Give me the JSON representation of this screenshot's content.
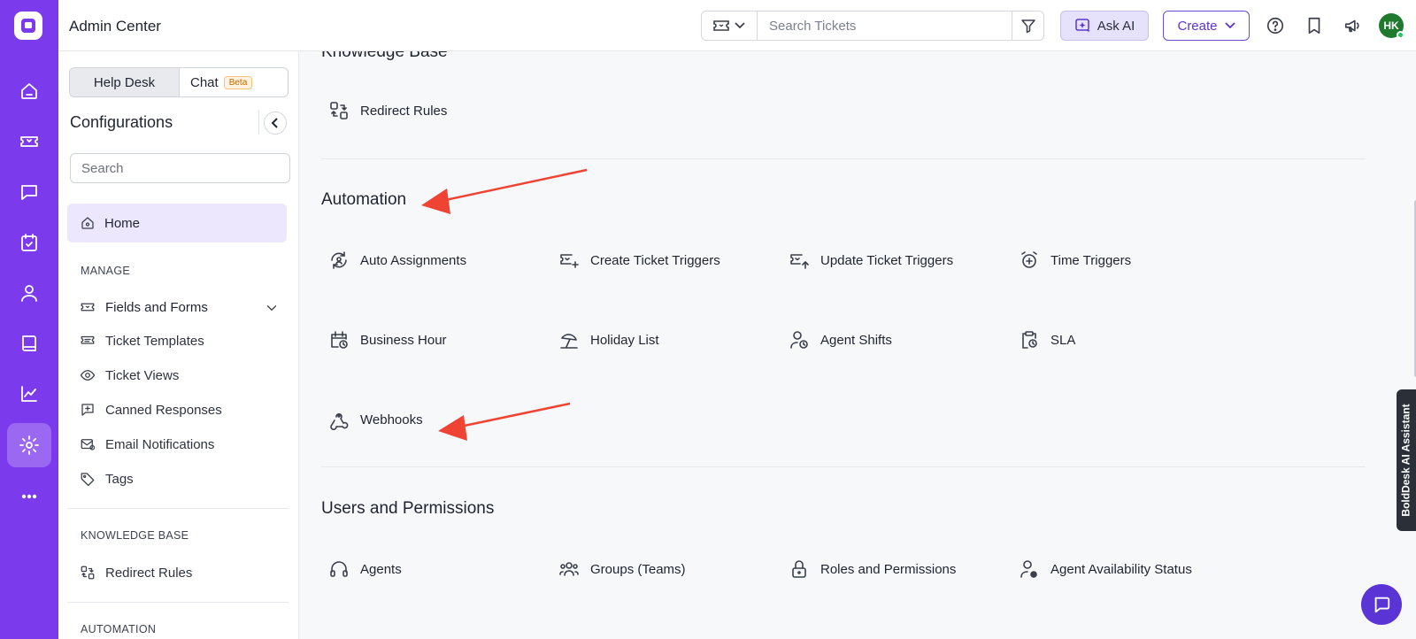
{
  "app": {
    "title": "Admin Center"
  },
  "topbar": {
    "search_placeholder": "Search Tickets",
    "ask_ai_label": "Ask AI",
    "create_label": "Create",
    "avatar_initials": "HK"
  },
  "config": {
    "tabs": [
      {
        "label": "Help Desk",
        "active": true
      },
      {
        "label": "Chat",
        "badge": "Beta"
      }
    ],
    "title": "Configurations",
    "search_placeholder": "Search",
    "home_label": "Home",
    "manage_section": "MANAGE",
    "manage_items": [
      {
        "label": "Fields and Forms",
        "icon": "ticket-field-icon"
      },
      {
        "label": "Ticket Templates",
        "icon": "ticket-template-icon"
      },
      {
        "label": "Ticket Views",
        "icon": "eye-icon"
      },
      {
        "label": "Canned Responses",
        "icon": "canned-response-icon"
      },
      {
        "label": "Email Notifications",
        "icon": "email-notification-icon"
      },
      {
        "label": "Tags",
        "icon": "tag-icon"
      }
    ],
    "kb_section": "KNOWLEDGE BASE",
    "kb_items": [
      {
        "label": "Redirect Rules",
        "icon": "redirect-icon"
      }
    ],
    "automation_section": "AUTOMATION"
  },
  "main": {
    "sections": [
      {
        "title": "Knowledge Base",
        "items": [
          {
            "label": "Redirect Rules",
            "icon": "redirect-icon"
          }
        ]
      },
      {
        "title": "Automation",
        "items": [
          {
            "label": "Auto Assignments",
            "icon": "auto-assign-icon"
          },
          {
            "label": "Create Ticket Triggers",
            "icon": "create-trigger-icon"
          },
          {
            "label": "Update Ticket Triggers",
            "icon": "update-trigger-icon"
          },
          {
            "label": "Time Triggers",
            "icon": "alarm-icon"
          },
          {
            "label": "Business Hour",
            "icon": "calendar-clock-icon"
          },
          {
            "label": "Holiday List",
            "icon": "beach-umbrella-icon"
          },
          {
            "label": "Agent Shifts",
            "icon": "user-clock-icon"
          },
          {
            "label": "SLA",
            "icon": "clipboard-clock-icon"
          },
          {
            "label": "Webhooks",
            "icon": "webhook-icon"
          }
        ]
      },
      {
        "title": "Users and Permissions",
        "items": [
          {
            "label": "Agents",
            "icon": "headset-icon"
          },
          {
            "label": "Groups (Teams)",
            "icon": "users-icon"
          },
          {
            "label": "Roles and Permissions",
            "icon": "lock-icon"
          },
          {
            "label": "Agent Availability Status",
            "icon": "user-status-icon"
          }
        ]
      }
    ]
  },
  "ai_assistant_tab": "BoldDesk AI Assistant",
  "colors": {
    "brand": "#7c3aed",
    "accent": "#5b34d6",
    "arrow": "#ef4433"
  }
}
